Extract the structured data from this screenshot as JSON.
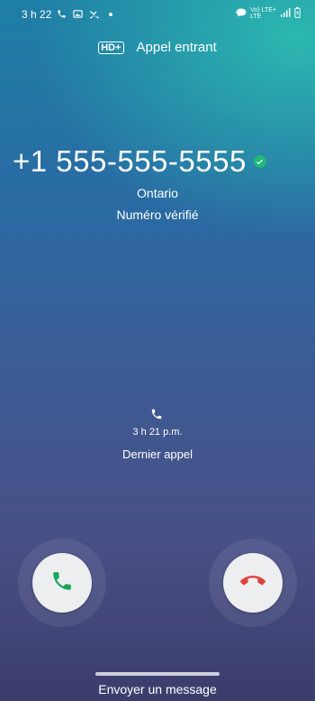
{
  "status_bar": {
    "time": "3 h 22",
    "left_icons": [
      "phone-icon",
      "image-icon",
      "missed-call-icon",
      "dot-icon"
    ],
    "network_top": "Vo) LTE+",
    "network_bottom": "LTE",
    "right_icons": [
      "chat-icon",
      "signal-icon",
      "battery-icon"
    ]
  },
  "header": {
    "hd_label": "HD+",
    "title": "Appel entrant"
  },
  "caller": {
    "number": "+1 555-555-5555",
    "location": "Ontario",
    "status": "Numéro vérifié",
    "verified_color": "#1fb979"
  },
  "last_call": {
    "time": "3 h 21 p.m.",
    "label": "Dernier appel"
  },
  "actions": {
    "accept_color": "#1aa55a",
    "decline_color": "#e0403a"
  },
  "footer": {
    "send_message": "Envoyer un message"
  }
}
